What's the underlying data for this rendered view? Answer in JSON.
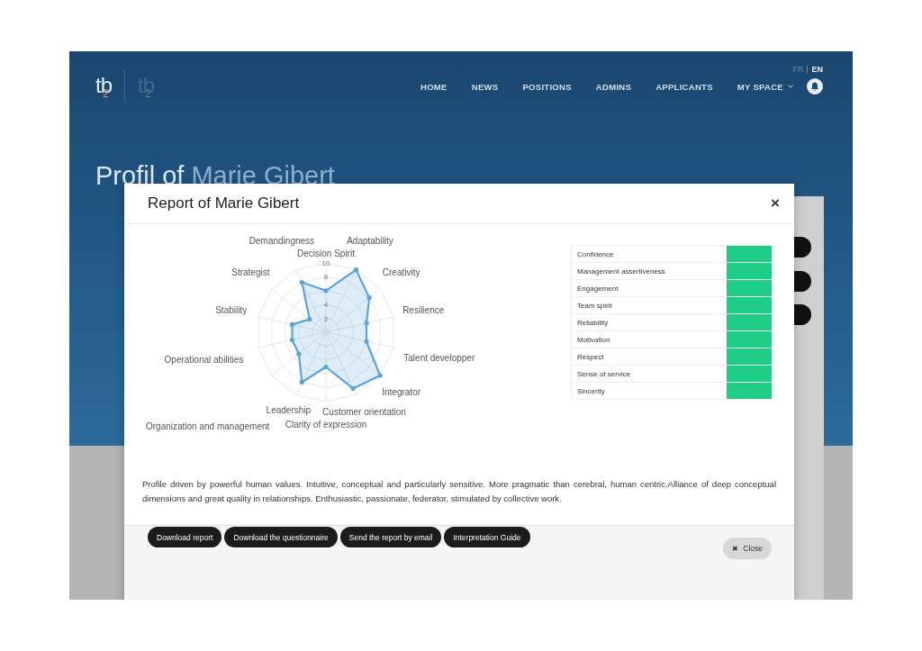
{
  "logos": [
    {
      "main": "tb",
      "sub": "2"
    },
    {
      "main": "tb",
      "sub": "2"
    }
  ],
  "languages": [
    {
      "label": "FR",
      "selected": false
    },
    {
      "label": "EN",
      "selected": true
    }
  ],
  "nav": [
    {
      "label": "HOME",
      "dropdown": false
    },
    {
      "label": "NEWS",
      "dropdown": false
    },
    {
      "label": "POSITIONS",
      "dropdown": false
    },
    {
      "label": "ADMINS",
      "dropdown": false
    },
    {
      "label": "APPLICANTS",
      "dropdown": false
    },
    {
      "label": "MY SPACE",
      "dropdown": true
    }
  ],
  "page_title": {
    "prefix": "Profil of",
    "name": "Marie Gibert"
  },
  "modal": {
    "title": "Report of Marie Gibert",
    "close_symbol": "×",
    "chart_data": {
      "type": "radar",
      "categories": [
        "Decision Spirit",
        "Adaptability",
        "Creativity",
        "Resilience",
        "Talent developper",
        "Integrator",
        "Customer orientation",
        "Clarity of expression",
        "Leadership",
        "Organization and management",
        "Operational abilities",
        "Stability",
        "Strategist",
        "Demandingness"
      ],
      "series": [
        {
          "color": "#5aa3dc",
          "values": [
            6,
            10,
            8,
            6,
            6,
            10,
            9,
            5,
            8,
            5,
            5,
            5,
            3,
            8
          ]
        }
      ],
      "ylim": [
        0,
        10
      ],
      "yticks": [
        2,
        4,
        8,
        10
      ]
    },
    "traits": [
      {
        "label": "Confidence",
        "color": "#1ecc84"
      },
      {
        "label": "Management assertiveness",
        "color": "#1ecc84"
      },
      {
        "label": "Engagement",
        "color": "#1ecc84"
      },
      {
        "label": "Team spirit",
        "color": "#1ecc84"
      },
      {
        "label": "Reliability",
        "color": "#1ecc84"
      },
      {
        "label": "Motivation",
        "color": "#1ecc84"
      },
      {
        "label": "Respect",
        "color": "#1ecc84"
      },
      {
        "label": "Sense of service",
        "color": "#1ecc84"
      },
      {
        "label": "Sincerity",
        "color": "#1ecc84"
      }
    ],
    "summary": "Profile driven by powerful human values. Intuitive, conceptual and particularly sensitive. More pragmatic than cerebral, human centric.Alliance of deep conceptual dimensions and great quality in relationships. Enthusiastic, passionate, federator, stimulated by collective work.",
    "actions": [
      "Download report",
      "Download the questionnaire",
      "Send the report by email",
      "Interpretation Guide"
    ],
    "footer_button": {
      "symbol": "✖",
      "label": "Close"
    }
  }
}
